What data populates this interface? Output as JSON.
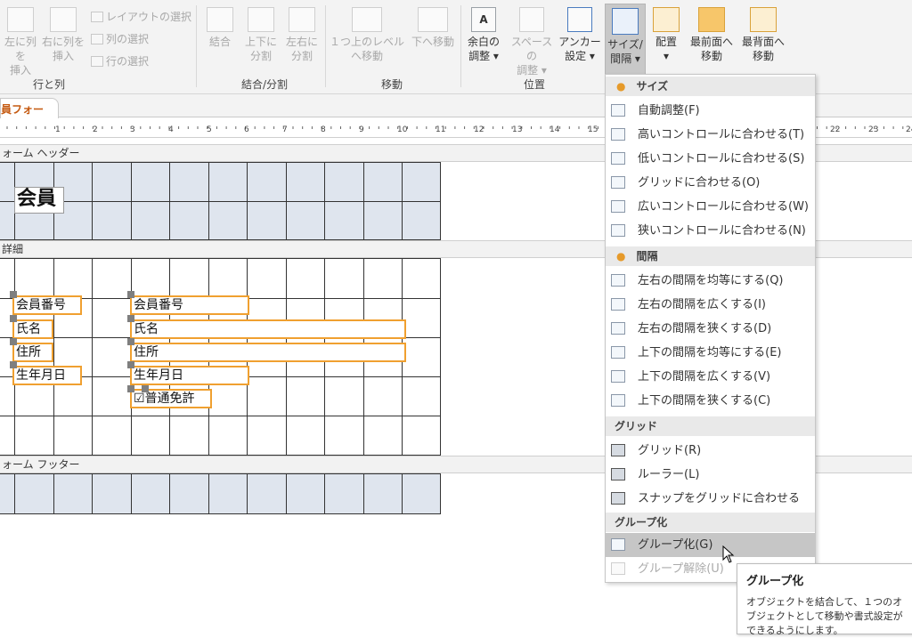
{
  "ribbon": {
    "row_col": {
      "insert_left": "左に列を\n挿入",
      "insert_right": "右に列を\n挿入",
      "select_layout": "レイアウトの選択",
      "select_column": "列の選択",
      "select_row": "行の選択",
      "group_label": "行と列"
    },
    "merge_split": {
      "merge": "結合",
      "split_vertical": "上下に\n分割",
      "split_horizontal": "左右に\n分割",
      "group_label": "結合/分割"
    },
    "move": {
      "move_up": "１つ上のレベル\nへ移動",
      "move_down": "下へ移動",
      "group_label": "移動"
    },
    "position": {
      "margins": "余白の\n調整 ▾",
      "padding": "スペースの\n調整 ▾",
      "anchor": "アンカー\n設定 ▾",
      "group_label": "位置"
    },
    "size_space": "サイズ/\n間隔 ▾",
    "align": "配置\n▾",
    "bring_front": "最前面へ\n移動",
    "send_back": "最背面へ\n移動"
  },
  "document_tab": "員フォーム",
  "ruler_marks": [
    "1",
    "2",
    "3",
    "4",
    "5",
    "6",
    "7",
    "8",
    "9",
    "10",
    "11",
    "12",
    "13",
    "14",
    "15",
    "16",
    "22",
    "23",
    "24"
  ],
  "sections": {
    "header": "ォーム ヘッダー",
    "detail": "詳細",
    "footer": "ォーム フッター"
  },
  "form": {
    "title": "会員",
    "labels": [
      "会員番号",
      "氏名",
      "住所",
      "生年月日"
    ],
    "fields": [
      "会員番号",
      "氏名",
      "住所",
      "生年月日"
    ],
    "checkbox_label": "普通免許"
  },
  "menu": {
    "size_header": "サイズ",
    "size_items": [
      "自動調整(F)",
      "高いコントロールに合わせる(T)",
      "低いコントロールに合わせる(S)",
      "グリッドに合わせる(O)",
      "広いコントロールに合わせる(W)",
      "狭いコントロールに合わせる(N)"
    ],
    "spacing_header": "間隔",
    "spacing_items": [
      "左右の間隔を均等にする(Q)",
      "左右の間隔を広くする(I)",
      "左右の間隔を狭くする(D)",
      "上下の間隔を均等にする(E)",
      "上下の間隔を広くする(V)",
      "上下の間隔を狭くする(C)"
    ],
    "grid_header": "グリッド",
    "grid_items": [
      "グリッド(R)",
      "ルーラー(L)",
      "スナップをグリッドに合わせる(N)"
    ],
    "group_header": "グループ化",
    "group_items": [
      "グループ化(G)",
      "グループ解除(U)"
    ]
  },
  "tooltip": {
    "title": "グループ化",
    "body": "オブジェクトを結合して、１つのオブジェクトとして移動や書式設定ができるようにします。"
  },
  "colors": {
    "selection": "#f0a030",
    "accent": "#c55a11",
    "menu_highlight": "#c6c6c6"
  }
}
